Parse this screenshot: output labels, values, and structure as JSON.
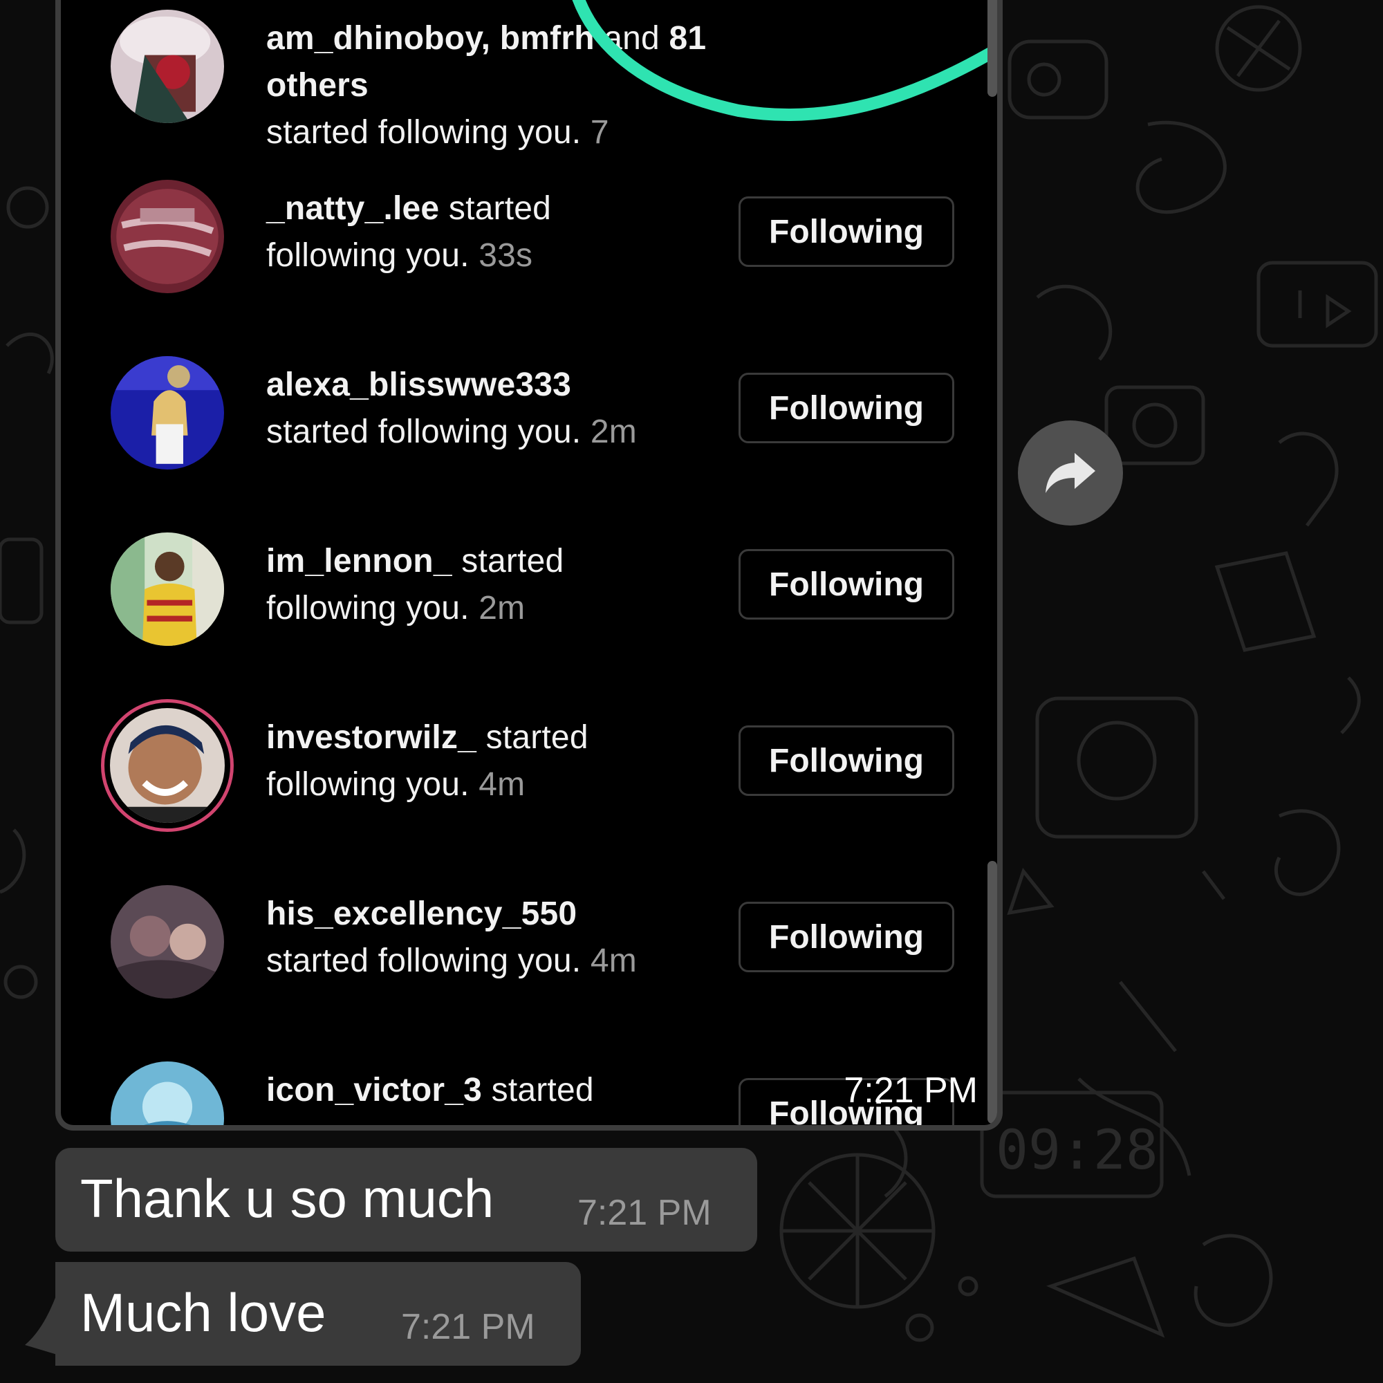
{
  "notifications": [
    {
      "username": "am_dhinoboy, bmfr",
      "username_tail": "h",
      "middle": " and ",
      "others": "81 others",
      "line2": "started following you.",
      "time": "7",
      "button": ""
    },
    {
      "username": "_natty_.lee",
      "text": " started",
      "line2": "following you.",
      "time": "33s",
      "button": "Following"
    },
    {
      "username": "alexa_blisswwe333",
      "text": "",
      "line2": "started following you.",
      "time": "2m",
      "button": "Following"
    },
    {
      "username": "im_lennon_",
      "text": " started",
      "line2": "following you.",
      "time": "2m",
      "button": "Following"
    },
    {
      "username": "investorwilz_",
      "text": " started",
      "line2": "following you.",
      "time": "4m",
      "button": "Following"
    },
    {
      "username": "his_excellency_550",
      "text": "",
      "line2": "started following you.",
      "time": "4m",
      "button": "Following"
    },
    {
      "username": "icon_victor_3",
      "text": " started",
      "line2": "",
      "time": "",
      "button": "Following"
    }
  ],
  "screenshot_message": {
    "time": "7:21 PM"
  },
  "messages": [
    {
      "text": "Thank u so much",
      "time": "7:21 PM"
    },
    {
      "text": "Much love",
      "time": "7:21 PM"
    }
  ],
  "wallpaper_clock": "09:28",
  "icons": {
    "forward": "forward-arrow-icon"
  },
  "colors": {
    "annotation": "#2fe3b1",
    "bubble": "#3a3a3a",
    "story_ring": "#d1446f"
  }
}
